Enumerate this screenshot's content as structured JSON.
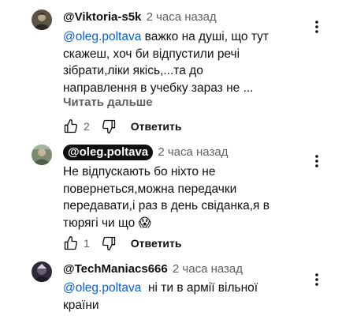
{
  "comments": [
    {
      "author": "@Viktoria-s5k",
      "time": "2 часа назад",
      "mention": "@oleg.poltava",
      "text_line1": " важко на душі, що тут",
      "text_line2": "скажеш, хоч би відпустили речі",
      "text_line3": "зібрати,ліки якісь,...та до",
      "text_line4": "направлення в учебку зараз не ...",
      "read_more": "Читать дальше",
      "likes": "2",
      "reply_label": "Ответить"
    },
    {
      "author": "@oleg.poltava",
      "time": "2 часа назад",
      "text_line1": "Не відпускають бо ніхто не",
      "text_line2": "повернеться,можна передачки",
      "text_line3": "передавати,і раз в день свіданка,я в",
      "text_line4": "тюрягі чи що 😱",
      "likes": "1",
      "reply_label": "Ответить"
    },
    {
      "author": "@TechManiacs666",
      "time": "2 часа назад",
      "mention": "@oleg.poltava",
      "text_line1": "  ні ти в армії вільної",
      "text_line2": "країни"
    }
  ],
  "icons": {
    "like": "thumb-up-icon",
    "dislike": "thumb-down-icon",
    "more": "more-vert-icon"
  },
  "colors": {
    "mention": "#065fd4",
    "secondary_text": "#606060",
    "author_chip_bg": "#0f0f0f"
  }
}
